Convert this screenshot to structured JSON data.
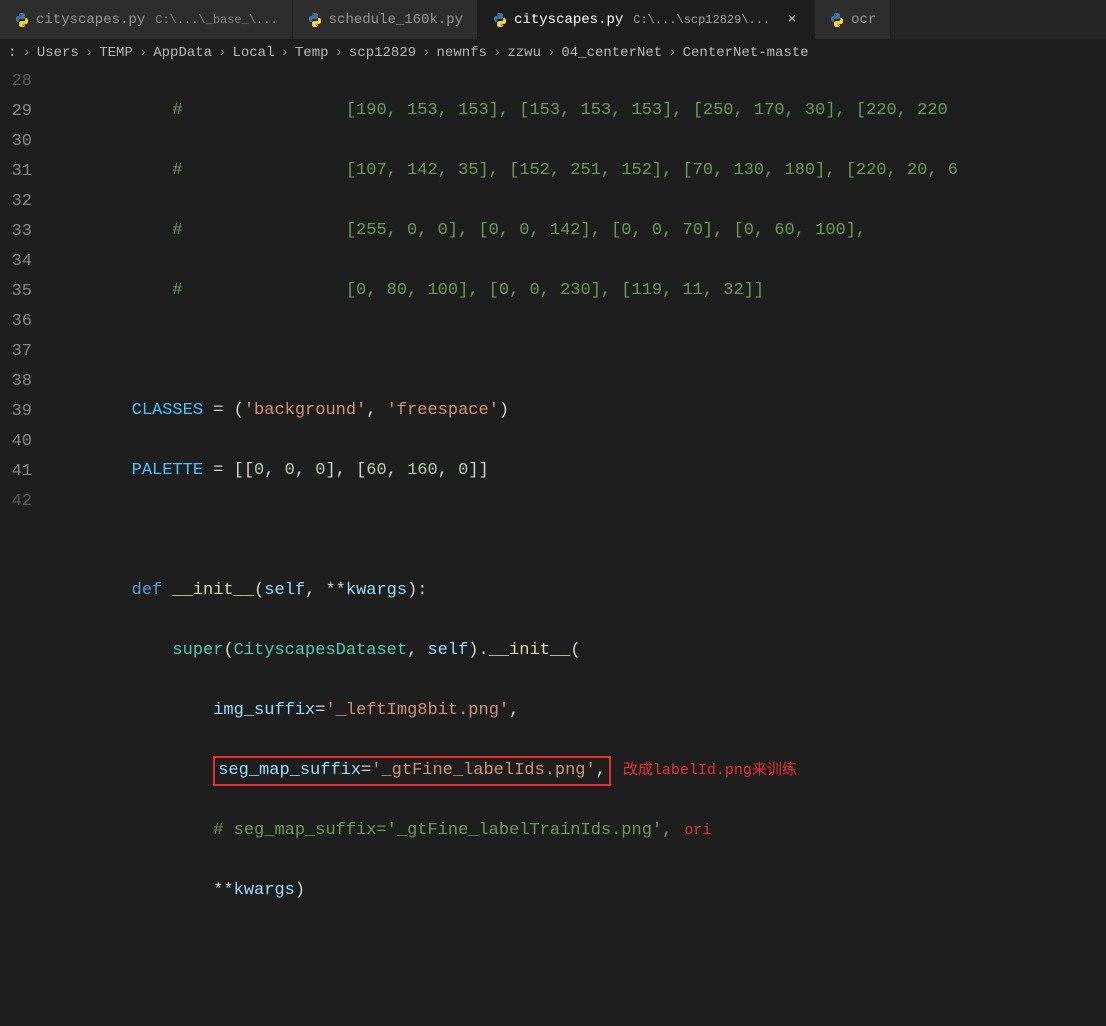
{
  "tabs": [
    {
      "icon": "python",
      "name": "cityscapes.py",
      "path": "C:\\...\\_base_\\...",
      "active": false,
      "close": ""
    },
    {
      "icon": "python",
      "name": "schedule_160k.py",
      "path": "",
      "active": false,
      "close": ""
    },
    {
      "icon": "python",
      "name": "cityscapes.py",
      "path": "C:\\...\\scp12829\\...",
      "active": true,
      "close": "×"
    },
    {
      "icon": "python",
      "name": "ocr",
      "path": "",
      "active": false,
      "close": ""
    }
  ],
  "breadcrumbs": [
    ":",
    "Users",
    "TEMP",
    "AppData",
    "Local",
    "Temp",
    "scp12829",
    "newnfs",
    "zzwu",
    "04_centerNet",
    "CenterNet-maste"
  ],
  "gutter": [
    "28",
    "29",
    "30",
    "31",
    "32",
    "33",
    "34",
    "35",
    "36",
    "37",
    "38",
    "39",
    "40",
    "41",
    "42"
  ],
  "code": {
    "l28_pre": "            #                [190, 153, 153], [153, 153, 153], [250, 170, 30], [220, 220",
    "l29_pre": "            #                [107, 142, 35], [152, 251, 152], [70, 130, 180], [220, 20, 6",
    "l30_pre": "            #                [255, 0, 0], [0, 0, 142], [0, 0, 70], [0, 60, 100],",
    "l31_pre": "            #                [0, 80, 100], [0, 0, 230], [119, 11, 32]]",
    "l33_var": "        CLASSES",
    "l33_eq": " = (",
    "l33_s1": "'background'",
    "l33_c": ", ",
    "l33_s2": "'freespace'",
    "l33_end": ")",
    "l34_var": "        PALETTE",
    "l34_eq": " = [[",
    "l34_n1": "0",
    "l34_n2": "0",
    "l34_n3": "0",
    "l34_n4": "60",
    "l34_n5": "160",
    "l34_n6": "0",
    "l36_def": "        def ",
    "l36_fn": "__init__",
    "l36_op": "(",
    "l36_self": "self",
    "l36_rest": ", **",
    "l36_kw": "kwargs",
    "l36_cp": "):",
    "l37_pre": "            ",
    "l37_super": "super",
    "l37_op": "(",
    "l37_cls": "CityscapesDataset",
    "l37_c1": ", ",
    "l37_self": "self",
    "l37_cp": ").",
    "l37_init": "__init__",
    "l37_op2": "(",
    "l38_pre": "                ",
    "l38_p": "img_suffix",
    "l38_eq": "=",
    "l38_s": "'_leftImg8bit.png'",
    "l38_c": ",",
    "l39_pre": "                ",
    "l39_p": "seg_map_suffix",
    "l39_eq": "=",
    "l39_s": "'_gtFine_labelIds.png'",
    "l39_c": ",",
    "l39_annot": "改成labelId.png来训练",
    "l40_pre": "                ",
    "l40_cmt": "# seg_map_suffix='_gtFine_labelTrainIds.png',",
    "l40_annot": "ori",
    "l41_pre": "                **",
    "l41_kw": "kwargs",
    "l41_cp": ")"
  }
}
